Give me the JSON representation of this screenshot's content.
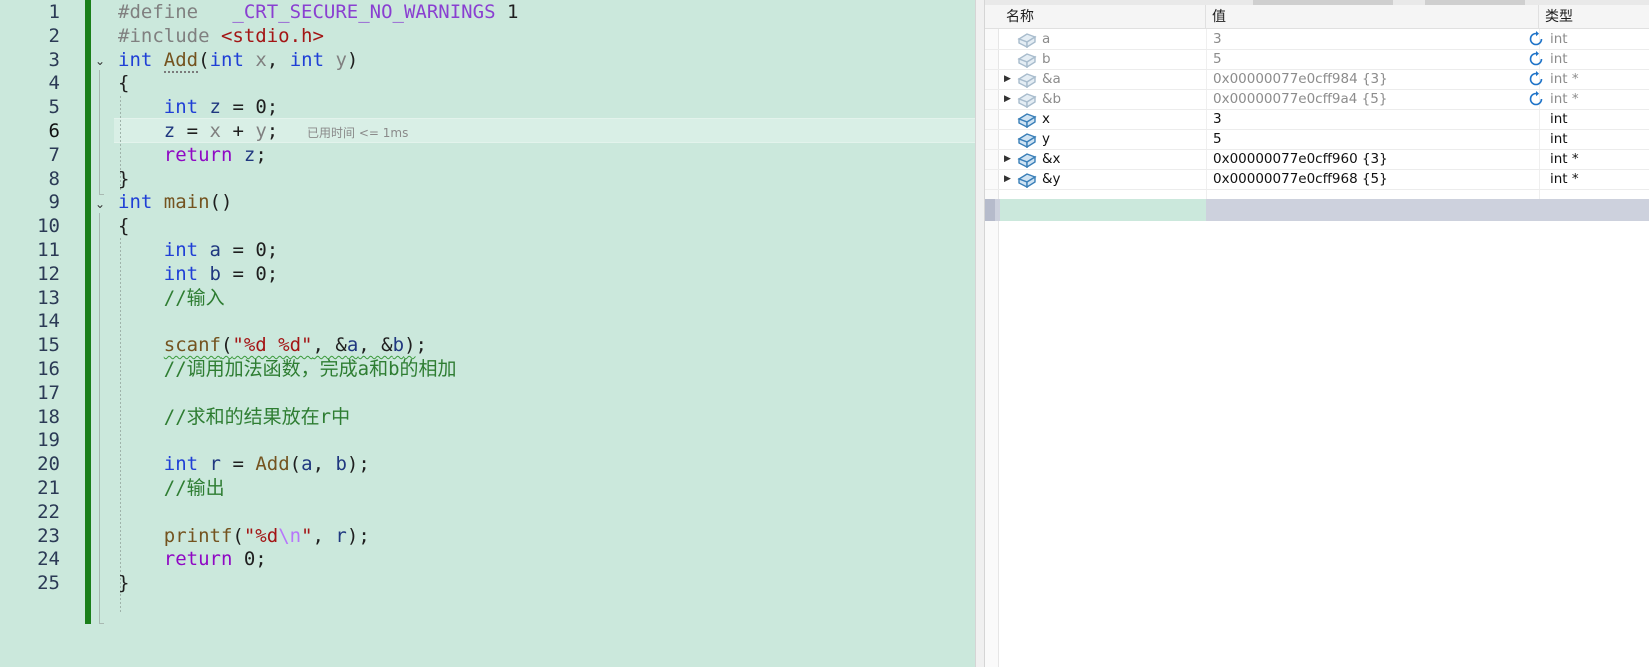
{
  "editor": {
    "timing_hint": "已用时间 <= 1ms",
    "current_line": 6,
    "lines": [
      {
        "n": "1",
        "tokens": [
          [
            "tk-pre",
            "#define"
          ],
          [
            "",
            "   "
          ],
          [
            "tk-macro",
            "_CRT_SECURE_NO_WARNINGS"
          ],
          [
            "tk-num",
            " 1"
          ]
        ]
      },
      {
        "n": "2",
        "tokens": [
          [
            "tk-pre",
            "#include "
          ],
          [
            "tk-str",
            "<stdio.h>"
          ]
        ]
      },
      {
        "n": "3",
        "tokens": [
          [
            "tk-kw",
            "int"
          ],
          [
            "",
            " "
          ],
          [
            "tk-fn dotted",
            "Add"
          ],
          [
            "",
            "("
          ],
          [
            "tk-kw",
            "int"
          ],
          [
            "",
            " "
          ],
          [
            "tk-param",
            "x"
          ],
          [
            "",
            ", "
          ],
          [
            "tk-kw",
            "int"
          ],
          [
            "",
            " "
          ],
          [
            "tk-param",
            "y"
          ],
          [
            "",
            ")"
          ]
        ]
      },
      {
        "n": "4",
        "tokens": [
          [
            "",
            "{"
          ]
        ]
      },
      {
        "n": "5",
        "tokens": [
          [
            "",
            "    "
          ],
          [
            "tk-kw",
            "int"
          ],
          [
            "",
            " "
          ],
          [
            "tk-var",
            "z"
          ],
          [
            "",
            " = 0;"
          ]
        ]
      },
      {
        "n": "6",
        "tokens": [
          [
            "",
            "    "
          ],
          [
            "tk-var",
            "z"
          ],
          [
            "",
            " = "
          ],
          [
            "tk-param",
            "x"
          ],
          [
            "",
            " + "
          ],
          [
            "tk-param",
            "y"
          ],
          [
            "",
            ";"
          ]
        ]
      },
      {
        "n": "7",
        "tokens": [
          [
            "",
            "    "
          ],
          [
            "tk-kw2",
            "return"
          ],
          [
            "",
            " "
          ],
          [
            "tk-var",
            "z"
          ],
          [
            "",
            ";"
          ]
        ]
      },
      {
        "n": "8",
        "tokens": [
          [
            "",
            "}"
          ]
        ]
      },
      {
        "n": "9",
        "tokens": [
          [
            "tk-kw",
            "int"
          ],
          [
            "",
            " "
          ],
          [
            "tk-fn",
            "main"
          ],
          [
            "",
            "()"
          ]
        ]
      },
      {
        "n": "10",
        "tokens": [
          [
            "",
            "{"
          ]
        ]
      },
      {
        "n": "11",
        "tokens": [
          [
            "",
            "    "
          ],
          [
            "tk-kw",
            "int"
          ],
          [
            "",
            " "
          ],
          [
            "tk-var",
            "a"
          ],
          [
            "",
            " = 0;"
          ]
        ]
      },
      {
        "n": "12",
        "tokens": [
          [
            "",
            "    "
          ],
          [
            "tk-kw",
            "int"
          ],
          [
            "",
            " "
          ],
          [
            "tk-var",
            "b"
          ],
          [
            "",
            " = 0;"
          ]
        ]
      },
      {
        "n": "13",
        "tokens": [
          [
            "",
            "    "
          ],
          [
            "tk-cmt",
            "//输入"
          ]
        ]
      },
      {
        "n": "14",
        "tokens": []
      },
      {
        "n": "15",
        "tokens": [
          [
            "",
            "    "
          ],
          [
            "tk-fn squiggle",
            "scanf"
          ],
          [
            "squiggle",
            "("
          ],
          [
            "tk-str squiggle",
            "\"%d %d\""
          ],
          [
            "squiggle",
            ", &"
          ],
          [
            "tk-var squiggle",
            "a"
          ],
          [
            "squiggle",
            ", &"
          ],
          [
            "tk-var squiggle",
            "b"
          ],
          [
            "squiggle",
            ")"
          ],
          [
            "",
            ";"
          ]
        ]
      },
      {
        "n": "16",
        "tokens": [
          [
            "",
            "    "
          ],
          [
            "tk-cmt",
            "//调用加法函数，完成a和b的相加"
          ]
        ]
      },
      {
        "n": "17",
        "tokens": []
      },
      {
        "n": "18",
        "tokens": [
          [
            "",
            "    "
          ],
          [
            "tk-cmt",
            "//求和的结果放在r中"
          ]
        ]
      },
      {
        "n": "19",
        "tokens": []
      },
      {
        "n": "20",
        "tokens": [
          [
            "",
            "    "
          ],
          [
            "tk-kw",
            "int"
          ],
          [
            "",
            " "
          ],
          [
            "tk-var",
            "r"
          ],
          [
            "",
            " = "
          ],
          [
            "tk-fn",
            "Add"
          ],
          [
            "",
            "("
          ],
          [
            "tk-var",
            "a"
          ],
          [
            "",
            ", "
          ],
          [
            "tk-var",
            "b"
          ],
          [
            "",
            ");"
          ]
        ]
      },
      {
        "n": "21",
        "tokens": [
          [
            "",
            "    "
          ],
          [
            "tk-cmt",
            "//输出"
          ]
        ]
      },
      {
        "n": "22",
        "tokens": []
      },
      {
        "n": "23",
        "tokens": [
          [
            "",
            "    "
          ],
          [
            "tk-fn",
            "printf"
          ],
          [
            "",
            "("
          ],
          [
            "tk-str",
            "\"%d"
          ],
          [
            "tk-esc",
            "\\n"
          ],
          [
            "tk-str",
            "\""
          ],
          [
            "",
            ", "
          ],
          [
            "tk-var",
            "r"
          ],
          [
            "",
            ");"
          ]
        ]
      },
      {
        "n": "24",
        "tokens": [
          [
            "",
            "    "
          ],
          [
            "tk-kw2",
            "return"
          ],
          [
            "",
            " 0;"
          ]
        ]
      },
      {
        "n": "25",
        "tokens": [
          [
            "",
            "}"
          ]
        ]
      }
    ]
  },
  "watch": {
    "headers": {
      "name": "名称",
      "value": "值",
      "type": "类型"
    },
    "rows": [
      {
        "name": "a",
        "value": "3",
        "type": "int",
        "stale": true,
        "expandable": false
      },
      {
        "name": "b",
        "value": "5",
        "type": "int",
        "stale": true,
        "expandable": false
      },
      {
        "name": "&a",
        "value": "0x00000077e0cff984 {3}",
        "type": "int *",
        "stale": true,
        "expandable": true
      },
      {
        "name": "&b",
        "value": "0x00000077e0cff9a4 {5}",
        "type": "int *",
        "stale": true,
        "expandable": true
      },
      {
        "name": "x",
        "value": "3",
        "type": "int",
        "stale": false,
        "expandable": false
      },
      {
        "name": "y",
        "value": "5",
        "type": "int",
        "stale": false,
        "expandable": false
      },
      {
        "name": "&x",
        "value": "0x00000077e0cff960 {3}",
        "type": "int *",
        "stale": false,
        "expandable": true
      },
      {
        "name": "&y",
        "value": "0x00000077e0cff968 {5}",
        "type": "int *",
        "stale": false,
        "expandable": true
      }
    ],
    "icons": {
      "variable": "variable-icon",
      "refresh": "refresh-icon",
      "expand": "expand-arrow-icon"
    }
  }
}
